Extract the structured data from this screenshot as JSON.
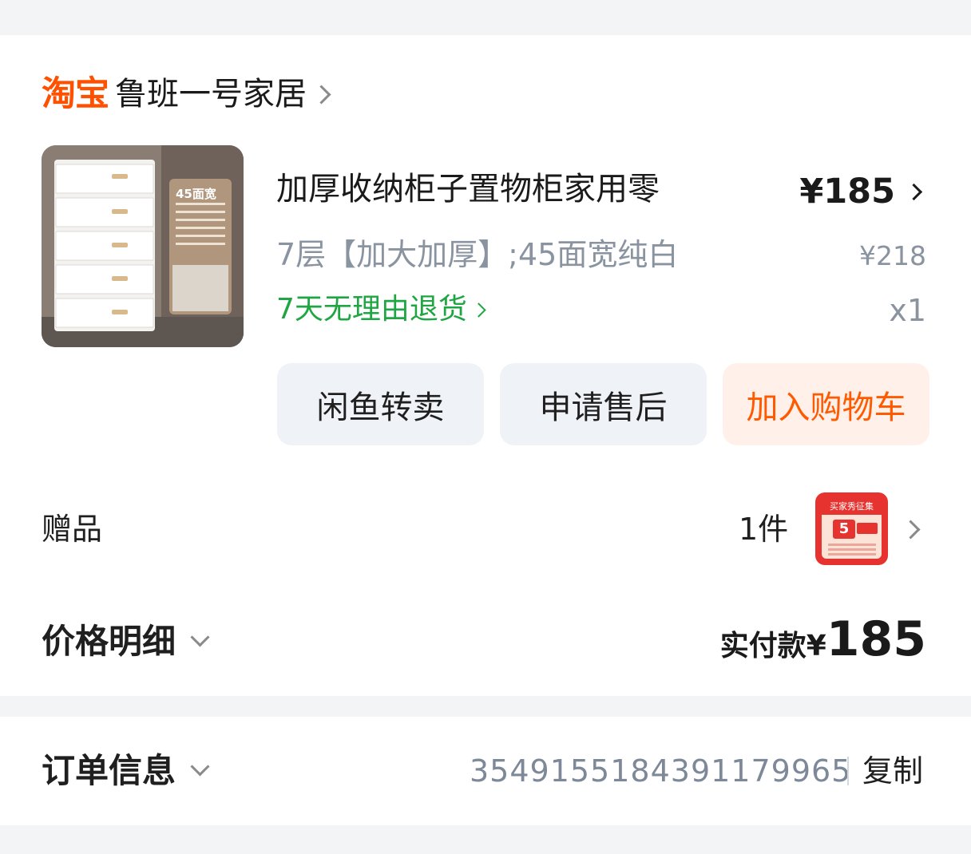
{
  "shop": {
    "platform_logo": "淘宝",
    "name": "鲁班一号家居",
    "chevron_icon": "chevron-right-icon"
  },
  "product": {
    "title": "加厚收纳柜子置物柜家用零",
    "price": "¥185",
    "spec": "7层【加大加厚】;45面宽纯白",
    "original_price": "¥218",
    "return_policy": "7天无理由退货",
    "quantity": "x1",
    "image_badge": "45面宽"
  },
  "actions": {
    "resell": "闲鱼转卖",
    "after_sale": "申请售后",
    "add_to_cart": "加入购物车"
  },
  "gift": {
    "label": "赠品",
    "count": "1件",
    "image_title": "买家秀征集",
    "image_number": "5"
  },
  "price_detail": {
    "label": "价格明细",
    "paid_label": "实付款¥",
    "paid_amount": "185"
  },
  "order": {
    "label": "订单信息",
    "number": "3549155184391179965",
    "copy": "复制"
  },
  "colors": {
    "brand_orange": "#ff5000",
    "green": "#1fa643",
    "cart_bg": "#fff1ea",
    "gray_text": "#8a93a0"
  }
}
